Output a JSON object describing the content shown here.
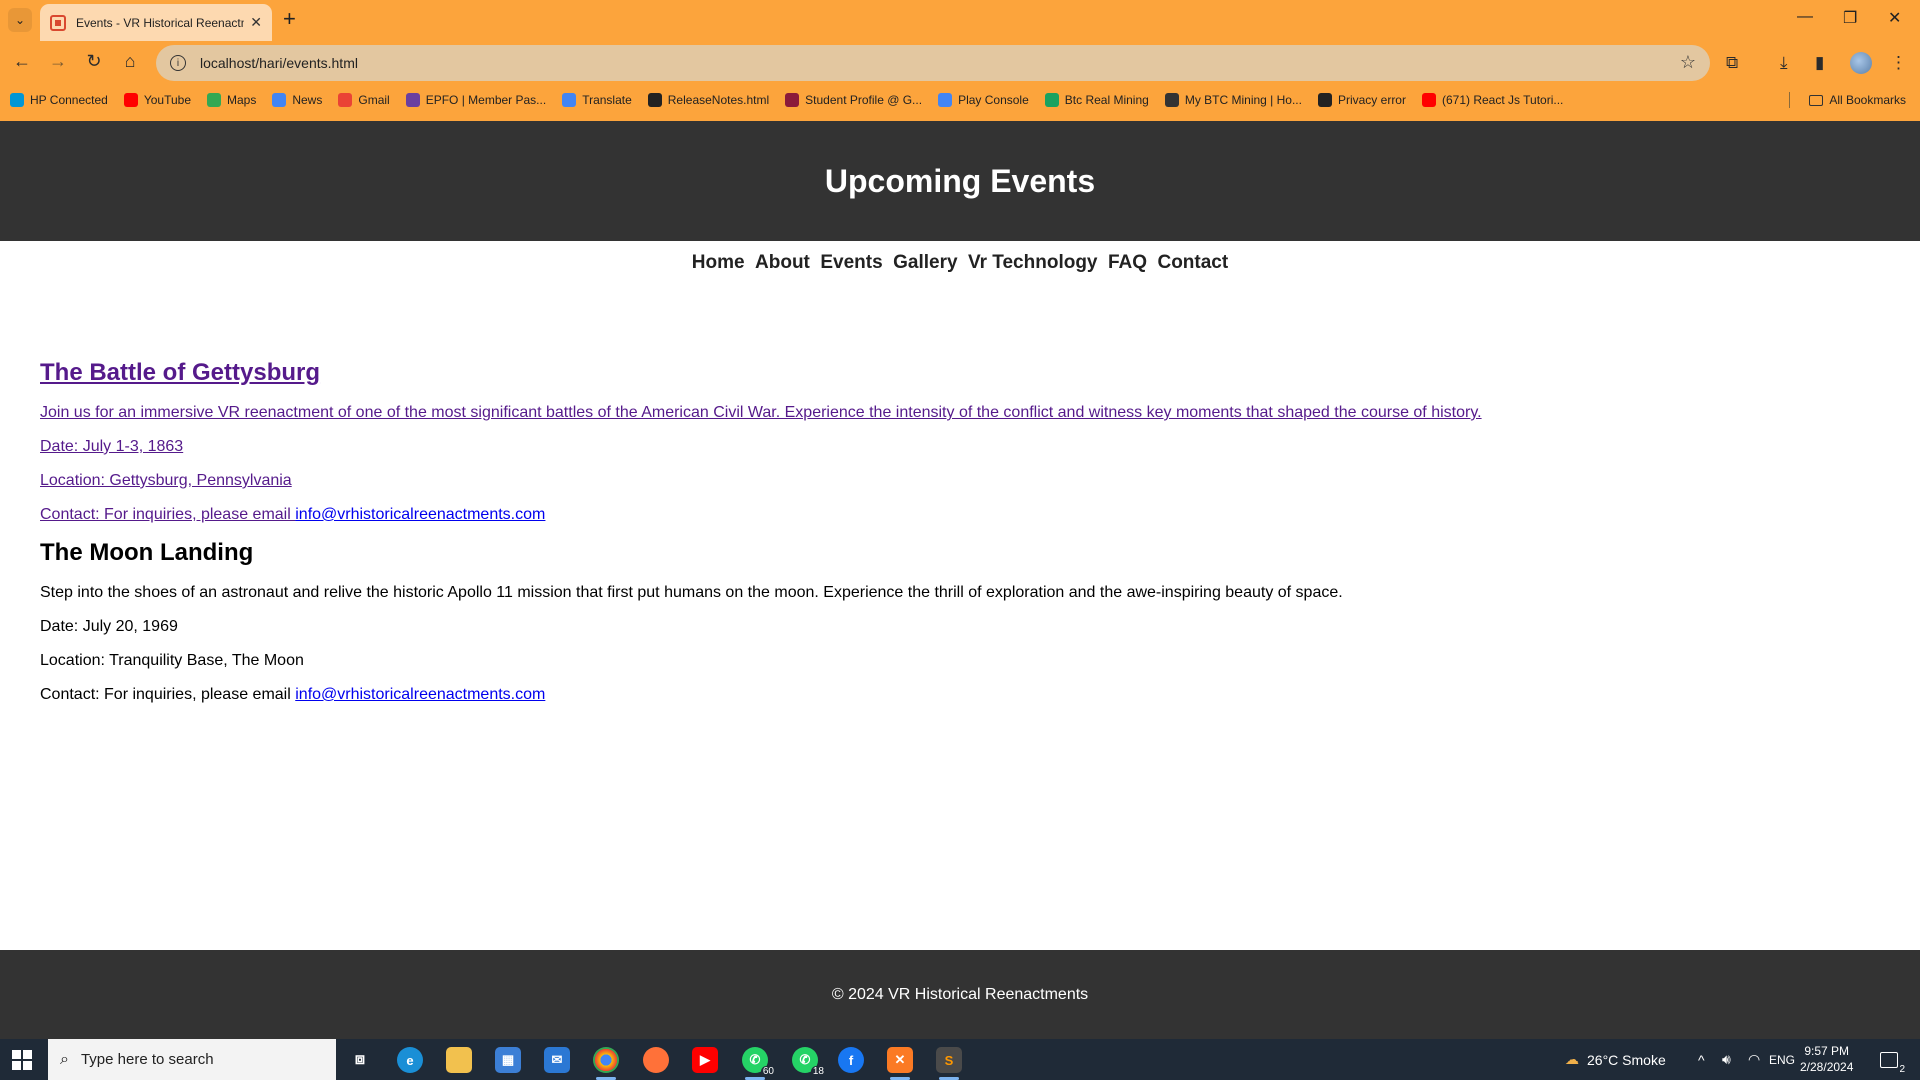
{
  "browser": {
    "tab_title": "Events - VR Historical Reenactm",
    "url": "localhost/hari/events.html",
    "bookmarks": [
      {
        "label": "HP Connected",
        "color": "#0096d6"
      },
      {
        "label": "YouTube",
        "color": "#ff0000"
      },
      {
        "label": "Maps",
        "color": "#34a853"
      },
      {
        "label": "News",
        "color": "#4285f4"
      },
      {
        "label": "Gmail",
        "color": "#ea4335"
      },
      {
        "label": "EPFO | Member Pas...",
        "color": "#6a3fa0"
      },
      {
        "label": "Translate",
        "color": "#4285f4"
      },
      {
        "label": "ReleaseNotes.html",
        "color": "#222222"
      },
      {
        "label": "Student Profile @ G...",
        "color": "#8b1a3a"
      },
      {
        "label": "Play Console",
        "color": "#4285f4"
      },
      {
        "label": "Btc Real Mining",
        "color": "#1aa260"
      },
      {
        "label": "My BTC Mining | Ho...",
        "color": "#333333"
      },
      {
        "label": "Privacy error",
        "color": "#222222"
      },
      {
        "label": "(671) React Js Tutori...",
        "color": "#ff0000"
      }
    ],
    "all_bookmarks": "All Bookmarks"
  },
  "site": {
    "header_title": "Upcoming Events",
    "nav": [
      "Home",
      "About",
      "Events",
      "Gallery",
      "Vr Technology",
      "FAQ",
      "Contact"
    ],
    "events": [
      {
        "title": "The Battle of Gettysburg",
        "description": "Join us for an immersive VR reenactment of one of the most significant battles of the American Civil War. Experience the intensity of the conflict and witness key moments that shaped the course of history.",
        "date": "Date: July 1-3, 1863",
        "location": "Location: Gettysburg, Pennsylvania",
        "contact_prefix": "Contact: For inquiries, please email ",
        "email": "info@vrhistoricalreenactments.com"
      },
      {
        "title": "The Moon Landing",
        "description": "Step into the shoes of an astronaut and relive the historic Apollo 11 mission that first put humans on the moon. Experience the thrill of exploration and the awe-inspiring beauty of space.",
        "date": "Date: July 20, 1969",
        "location": "Location: Tranquility Base, The Moon",
        "contact_prefix": "Contact: For inquiries, please email ",
        "email": "info@vrhistoricalreenactments.com"
      }
    ],
    "footer": "© 2024 VR Historical Reenactments"
  },
  "taskbar": {
    "search_placeholder": "Type here to search",
    "whatsapp_badge_1": "60",
    "whatsapp_badge_2": "18",
    "weather": "26°C  Smoke",
    "language": "ENG",
    "time": "9:57 PM",
    "date": "2/28/2024",
    "notifications": "2"
  },
  "colors": {
    "chrome": "#fca43c",
    "header_bg": "#333333",
    "visited_link": "#551a8b",
    "link": "#0000ee"
  }
}
